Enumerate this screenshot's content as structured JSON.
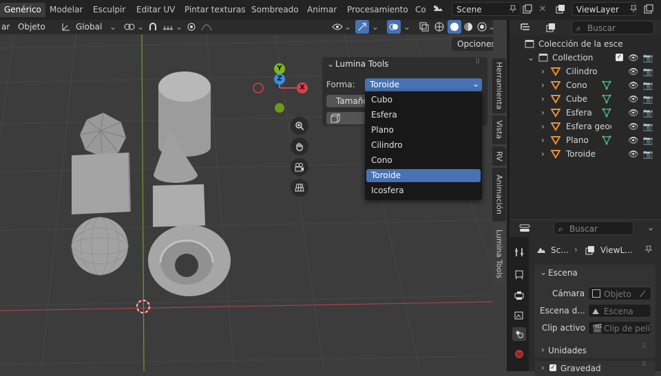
{
  "workspace_tabs": [
    "Genérico",
    "Modelar",
    "Esculpir",
    "Editar UV",
    "Pintar texturas",
    "Sombreado",
    "Animar",
    "Procesamiento",
    "Co"
  ],
  "top": {
    "scene": "Scene",
    "view_layer": "ViewLayer"
  },
  "viewport_header": {
    "menu1": "ar",
    "menu2": "Objeto",
    "orientation": "Global",
    "options": "Opciones"
  },
  "gizmo": {
    "x": "X",
    "y": "Y",
    "z": "Z"
  },
  "side_tabs": [
    "Herramienta",
    "Vista",
    "RV",
    "Animación",
    "Lumina Tools"
  ],
  "panel": {
    "title": "Lumina Tools",
    "shape_label": "Forma:",
    "shape_value": "Toroide",
    "size_label": "Tamaño"
  },
  "dropdown": {
    "options": [
      "Cubo",
      "Esfera",
      "Plano",
      "Cilindro",
      "Cono",
      "Toroide",
      "Icosfera"
    ],
    "selected": "Toroide"
  },
  "outliner": {
    "search_placeholder": "Buscar",
    "scene_collection": "Colección de la esce",
    "collection": "Collection",
    "items": [
      "Cilindro",
      "Cono",
      "Cube",
      "Esfera",
      "Esfera geode",
      "Plano",
      "Toroide"
    ]
  },
  "properties": {
    "search_placeholder": "Buscar",
    "breadcrumb_scene": "Sc...",
    "breadcrumb_layer": "ViewL...",
    "section_scene": "Escena",
    "camera_label": "Cámara",
    "camera_placeholder": "Objeto",
    "scene_label": "Escena d...",
    "scene_placeholder": "Escena",
    "clip_label": "Clip activo",
    "clip_placeholder": "Clip de pelíc",
    "section_units": "Unidades",
    "section_gravity": "Gravedad"
  },
  "colors": {
    "accent": "#4772b3",
    "x_axis": "#d6404f",
    "y_axis": "#7fb51f",
    "z_axis": "#3b8fe0",
    "object_icon": "#e8913a",
    "mesh_icon": "#47c48c"
  }
}
